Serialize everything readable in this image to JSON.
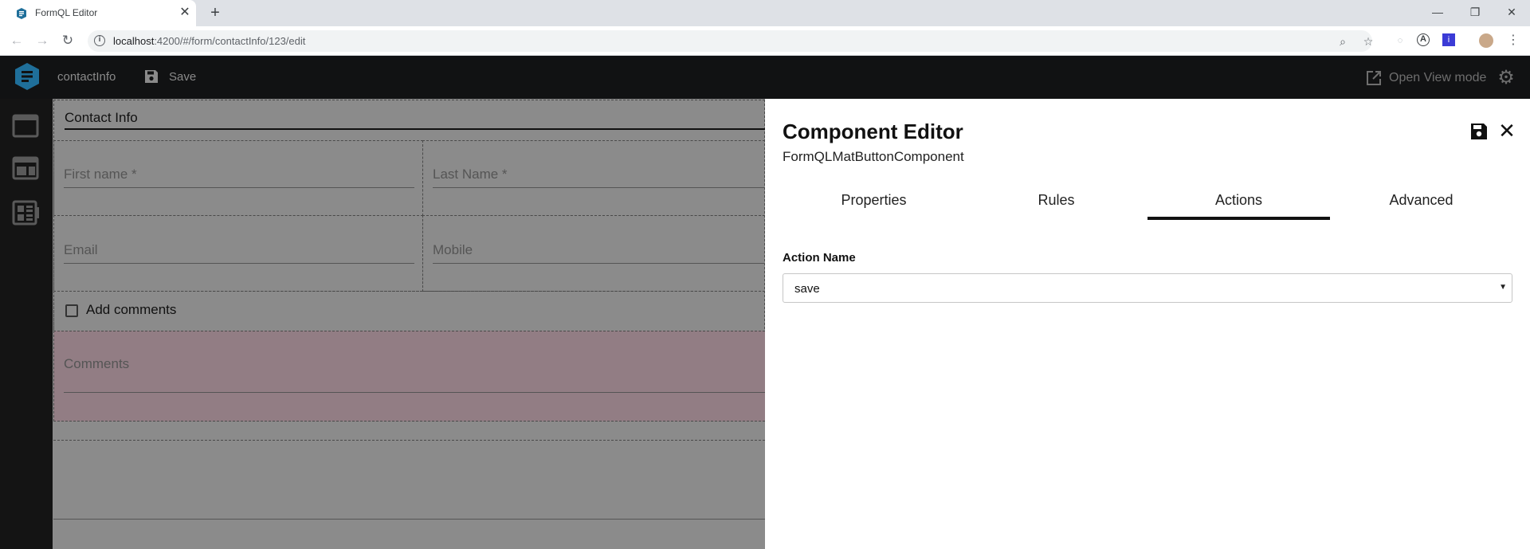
{
  "browser": {
    "tab_title": "FormQL Editor",
    "tab_close": "✕",
    "new_tab": "+",
    "url_host": "localhost",
    "url_path": ":4200/#/form/contactInfo/123/edit"
  },
  "app": {
    "title": "contactInfo",
    "save_label": "Save",
    "open_view_label": "Open View mode"
  },
  "form": {
    "title": "Contact Info",
    "first_name_label": "First name *",
    "last_name_label": "Last Name *",
    "email_label": "Email",
    "mobile_label": "Mobile",
    "add_comments_label": "Add comments",
    "comments_label": "Comments"
  },
  "editor": {
    "title": "Component Editor",
    "subtitle": "FormQLMatButtonComponent",
    "tabs": [
      {
        "label": "Properties",
        "active": false
      },
      {
        "label": "Rules",
        "active": false
      },
      {
        "label": "Actions",
        "active": true
      },
      {
        "label": "Advanced",
        "active": false
      }
    ],
    "action_name_label": "Action Name",
    "action_name_value": "save"
  },
  "colors": {
    "header_bg": "#111213",
    "sidebar_bg": "#141414",
    "overlay_gray": "#8b8b8b",
    "comments_tint": "#927d84",
    "logo_blue": "#1f6f9a"
  }
}
